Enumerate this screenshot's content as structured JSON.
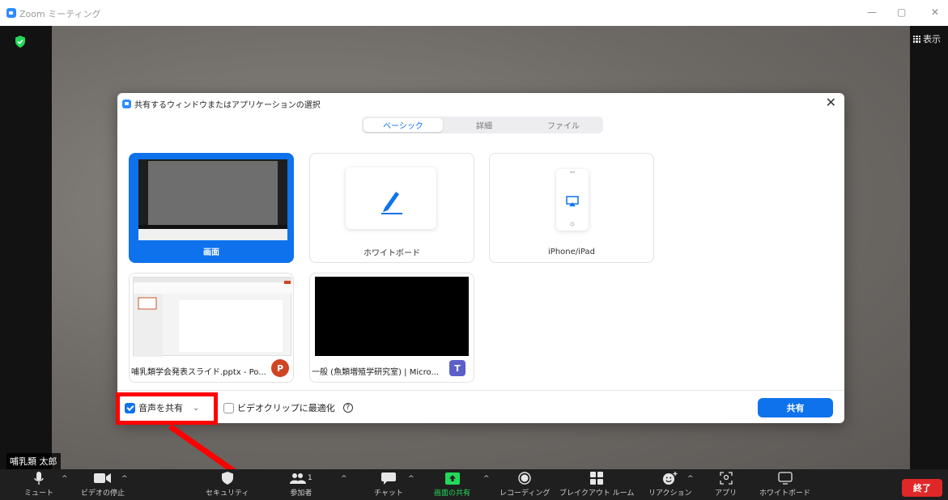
{
  "window": {
    "title": "Zoom ミーティング",
    "minimize": "—",
    "restore": "▢",
    "close": "✕"
  },
  "meeting": {
    "view_label": "表示",
    "participant_name": "哺乳類 太郎"
  },
  "dialog": {
    "title": "共有するウィンドウまたはアプリケーションの選択",
    "close": "✕",
    "tabs": [
      {
        "label": "ベーシック",
        "active": true
      },
      {
        "label": "詳細",
        "active": false
      },
      {
        "label": "ファイル",
        "active": false
      }
    ],
    "cards": {
      "screen": "画面",
      "whiteboard": "ホワイトボード",
      "iphone": "iPhone/iPad",
      "ppt": "哺乳類学会発表スライド.pptx - Po...",
      "teams": "一般 (魚類増殖学研究室) | Micro..."
    },
    "app_badges": {
      "ppt": "P",
      "teams": "T"
    },
    "share_audio": {
      "label": "音声を共有",
      "checked": true,
      "caret": "⌄"
    },
    "optimize_video": {
      "label": "ビデオクリップに最適化",
      "checked": false
    },
    "help": "?",
    "share_button": "共有"
  },
  "toolbar": {
    "items": [
      {
        "label": "ミュート"
      },
      {
        "label": "ビデオの停止"
      },
      {
        "label": "セキュリティ"
      },
      {
        "label": "参加者",
        "count": "1"
      },
      {
        "label": "チャット"
      },
      {
        "label": "画面の共有"
      },
      {
        "label": "レコーディング"
      },
      {
        "label": "ブレイクアウト ルーム"
      },
      {
        "label": "リアクション"
      },
      {
        "label": "アプリ"
      },
      {
        "label": "ホワイトボード"
      }
    ],
    "caret": "^",
    "end_label": "終了"
  },
  "colors": {
    "accent": "#0e72ed",
    "highlight": "#ff0000",
    "share_green": "#23d959",
    "end_red": "#e02828"
  }
}
